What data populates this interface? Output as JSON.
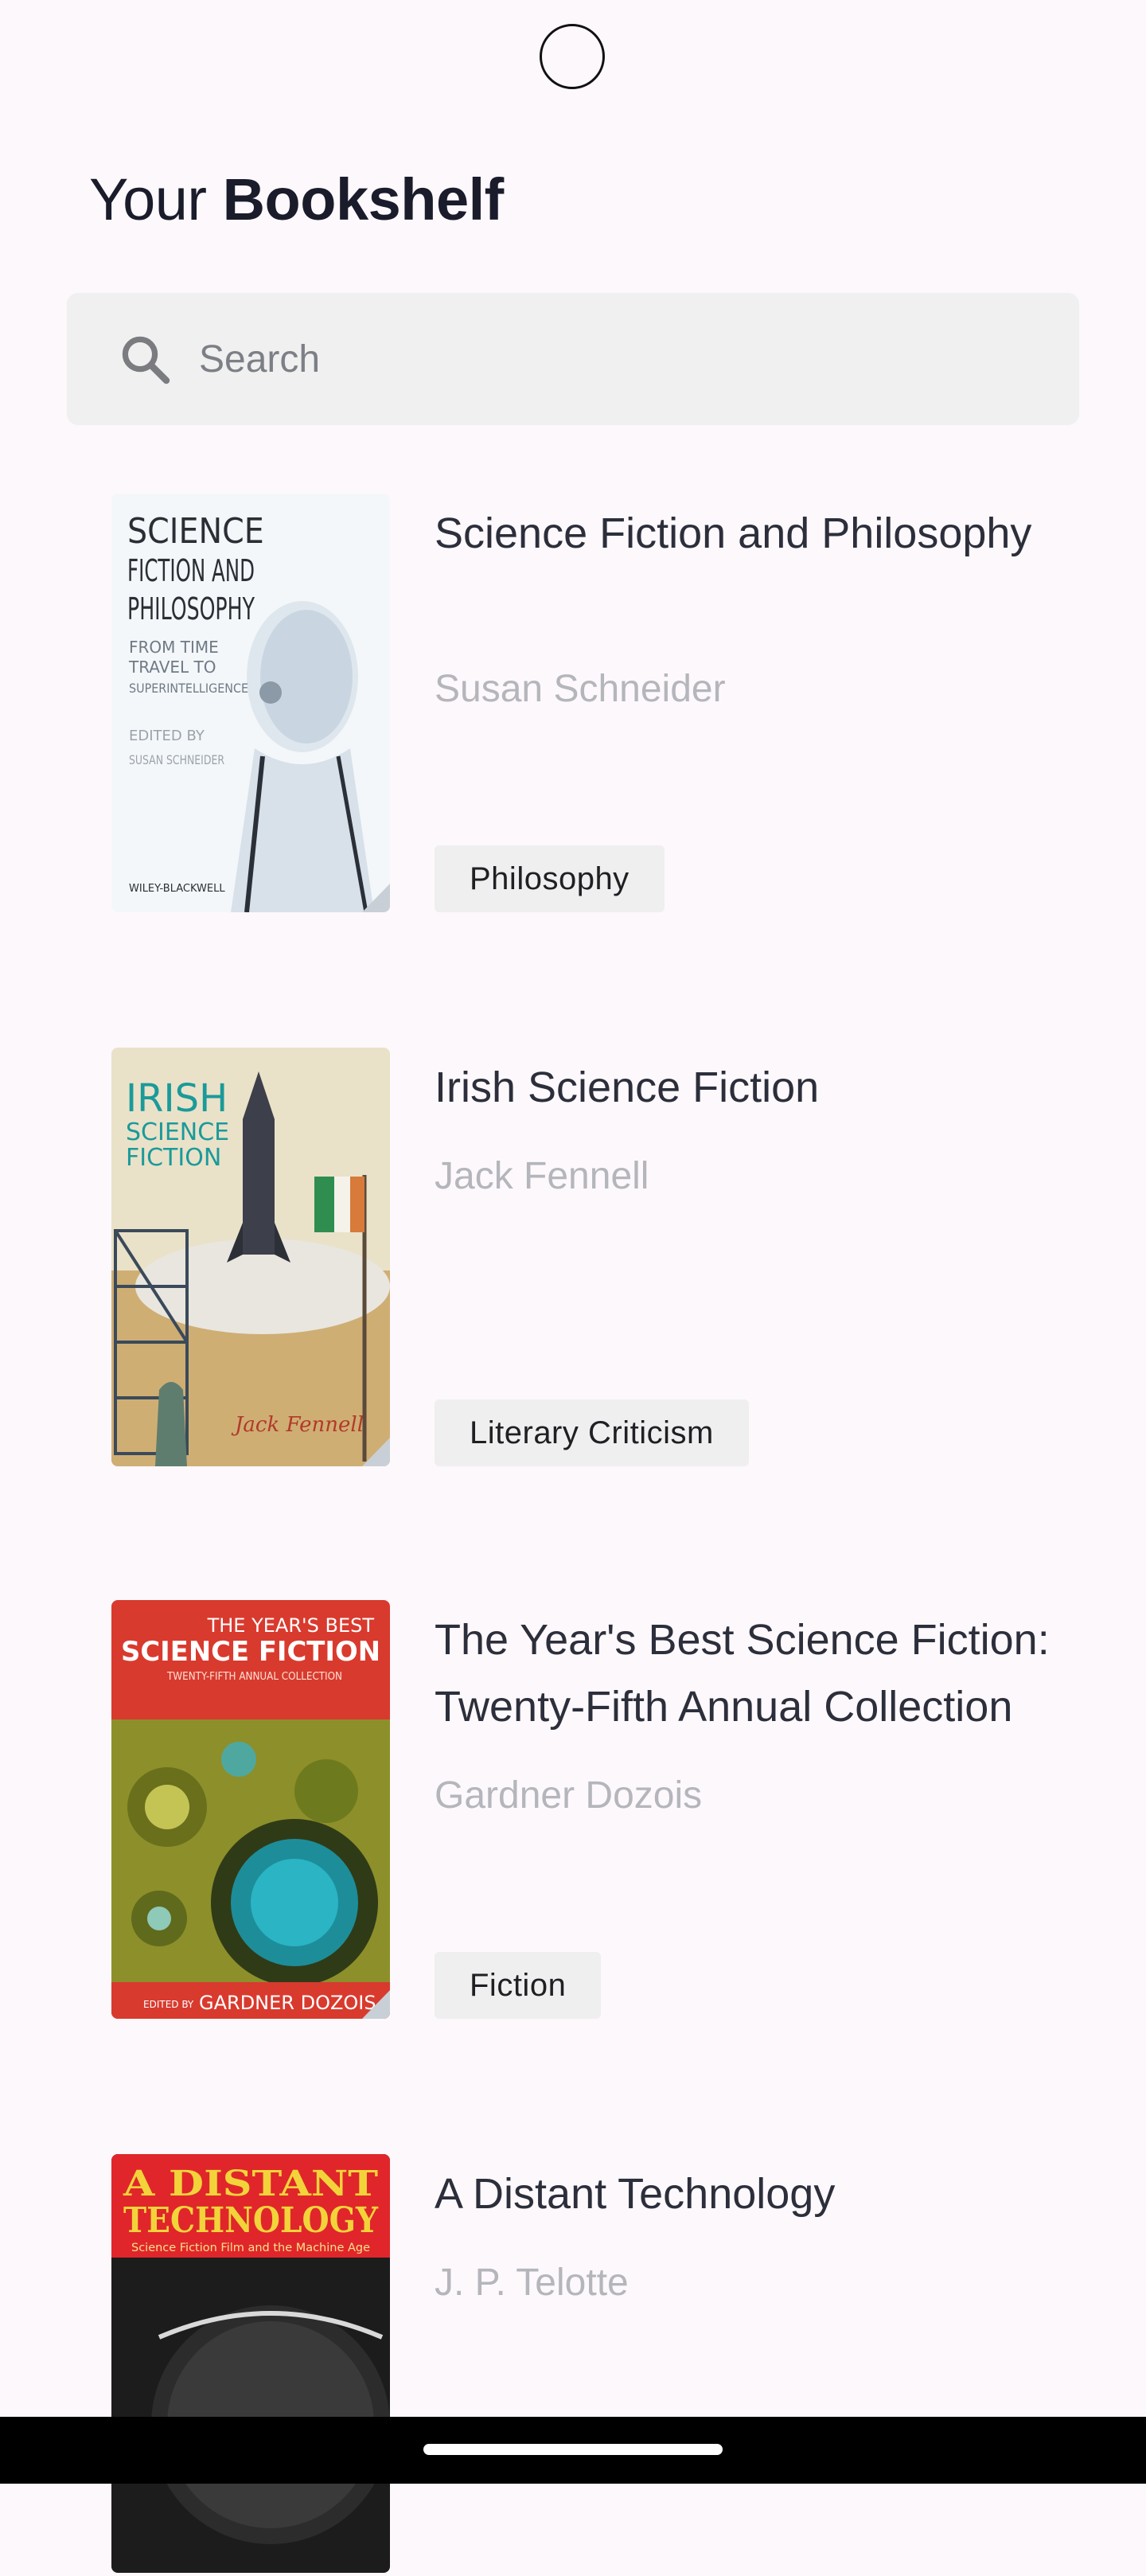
{
  "header": {
    "title_prefix": "Your",
    "title_bold": "Bookshelf"
  },
  "search": {
    "placeholder": "Search",
    "icon": "search-icon"
  },
  "books": [
    {
      "title": "Science Fiction and Philosophy",
      "author": "Susan Schneider",
      "genre": "Philosophy",
      "cover_text": [
        "SCIENCE",
        "FICTION AND",
        "PHILOSOPHY",
        "FROM TIME",
        "TRAVEL TO",
        "SUPERINTELLIGENCE",
        "EDITED BY",
        "SUSAN SCHNEIDER",
        "WILEY-BLACKWELL"
      ]
    },
    {
      "title": "Irish Science Fiction",
      "author": "Jack Fennell",
      "genre": "Literary Criticism",
      "cover_text": [
        "IRISH",
        "SCIENCE",
        "FICTION",
        "Jack Fennell"
      ]
    },
    {
      "title": "The Year's Best Science Fiction: Twenty-Fifth Annual Collection",
      "author": "Gardner Dozois",
      "genre": "Fiction",
      "cover_text": [
        "THE YEAR'S BEST",
        "SCIENCE FICTION",
        "TWENTY-FIFTH ANNUAL COLLECTION",
        "EDITED BY",
        "GARDNER DOZOIS"
      ]
    },
    {
      "title": "A Distant Technology",
      "author": "J. P. Telotte",
      "genre": "",
      "cover_text": [
        "A DISTANT",
        "TECHNOLOGY",
        "Science Fiction Film and the Machine Age"
      ]
    }
  ],
  "colors": {
    "background": "#fdf8fb",
    "title": "#1a1c2b",
    "author": "#b4b6bb",
    "chip": "#efefef",
    "search_bg": "#eff0ef"
  }
}
